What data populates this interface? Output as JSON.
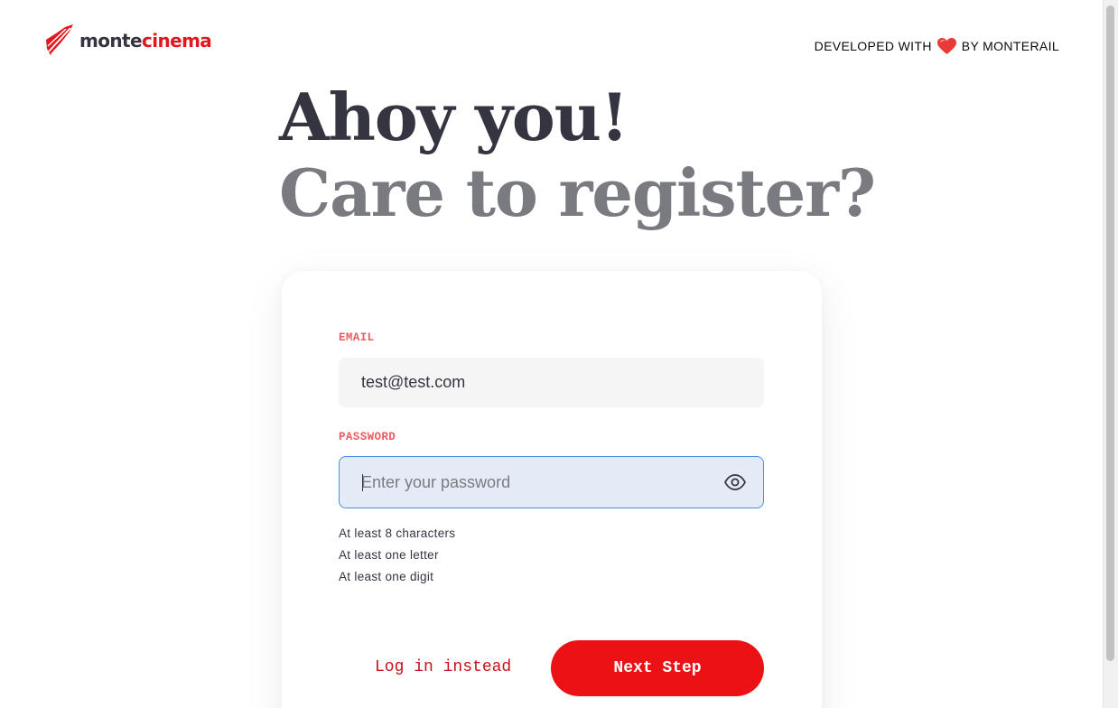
{
  "header": {
    "logo": {
      "part1": "monte",
      "part2": "cinema"
    },
    "credits": {
      "before": "DEVELOPED WITH",
      "icon": "heart-icon",
      "after": "BY MONTERAIL"
    }
  },
  "headline": {
    "line1": "Ahoy you!",
    "line2": "Care to register?"
  },
  "form": {
    "email": {
      "label": "EMAIL",
      "value": "test@test.com",
      "placeholder": ""
    },
    "password": {
      "label": "PASSWORD",
      "value": "",
      "placeholder": "Enter your password",
      "toggle_icon": "eye-icon"
    },
    "rules": [
      "At least 8 characters",
      "At least one letter",
      "At least one digit"
    ],
    "login_link": "Log in instead",
    "next_button": "Next Step"
  },
  "colors": {
    "brand_red": "#ec1115",
    "label_red": "#ec5b61",
    "heading_dark": "#343541",
    "heading_gray": "#7a7b81",
    "focus_blue": "#4a8ee8"
  }
}
